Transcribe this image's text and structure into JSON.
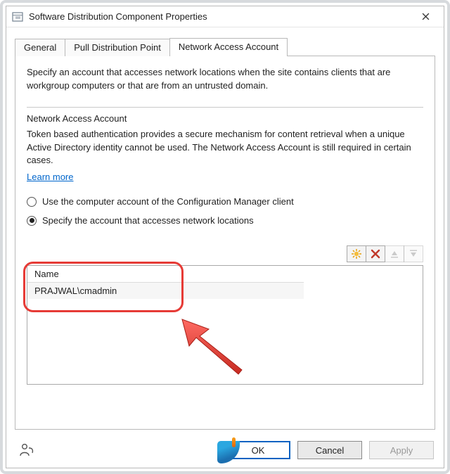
{
  "window": {
    "title": "Software Distribution Component Properties",
    "close_label": "Close"
  },
  "tabs": {
    "general": "General",
    "pull": "Pull Distribution Point",
    "naa": "Network Access Account"
  },
  "pane": {
    "intro": "Specify an account that accesses network locations when the site contains clients that are workgroup computers or that are from an untrusted domain.",
    "group_title": "Network Access Account",
    "group_text": "Token based authentication provides a secure mechanism for content retrieval when a unique Active Directory identity cannot be used. The Network Access Account is still required in certain cases.",
    "learn_more": "Learn more",
    "radio_computer": "Use the computer account of the Configuration Manager client",
    "radio_specify": "Specify the account that accesses network locations"
  },
  "toolbar": {
    "add": "New",
    "delete": "Delete",
    "moveup": "Move Up",
    "movedown": "Move Down"
  },
  "list": {
    "header_name": "Name",
    "rows": [
      {
        "name": "PRAJWAL\\cmadmin"
      }
    ]
  },
  "buttons": {
    "ok": "OK",
    "cancel": "Cancel",
    "apply": "Apply"
  }
}
